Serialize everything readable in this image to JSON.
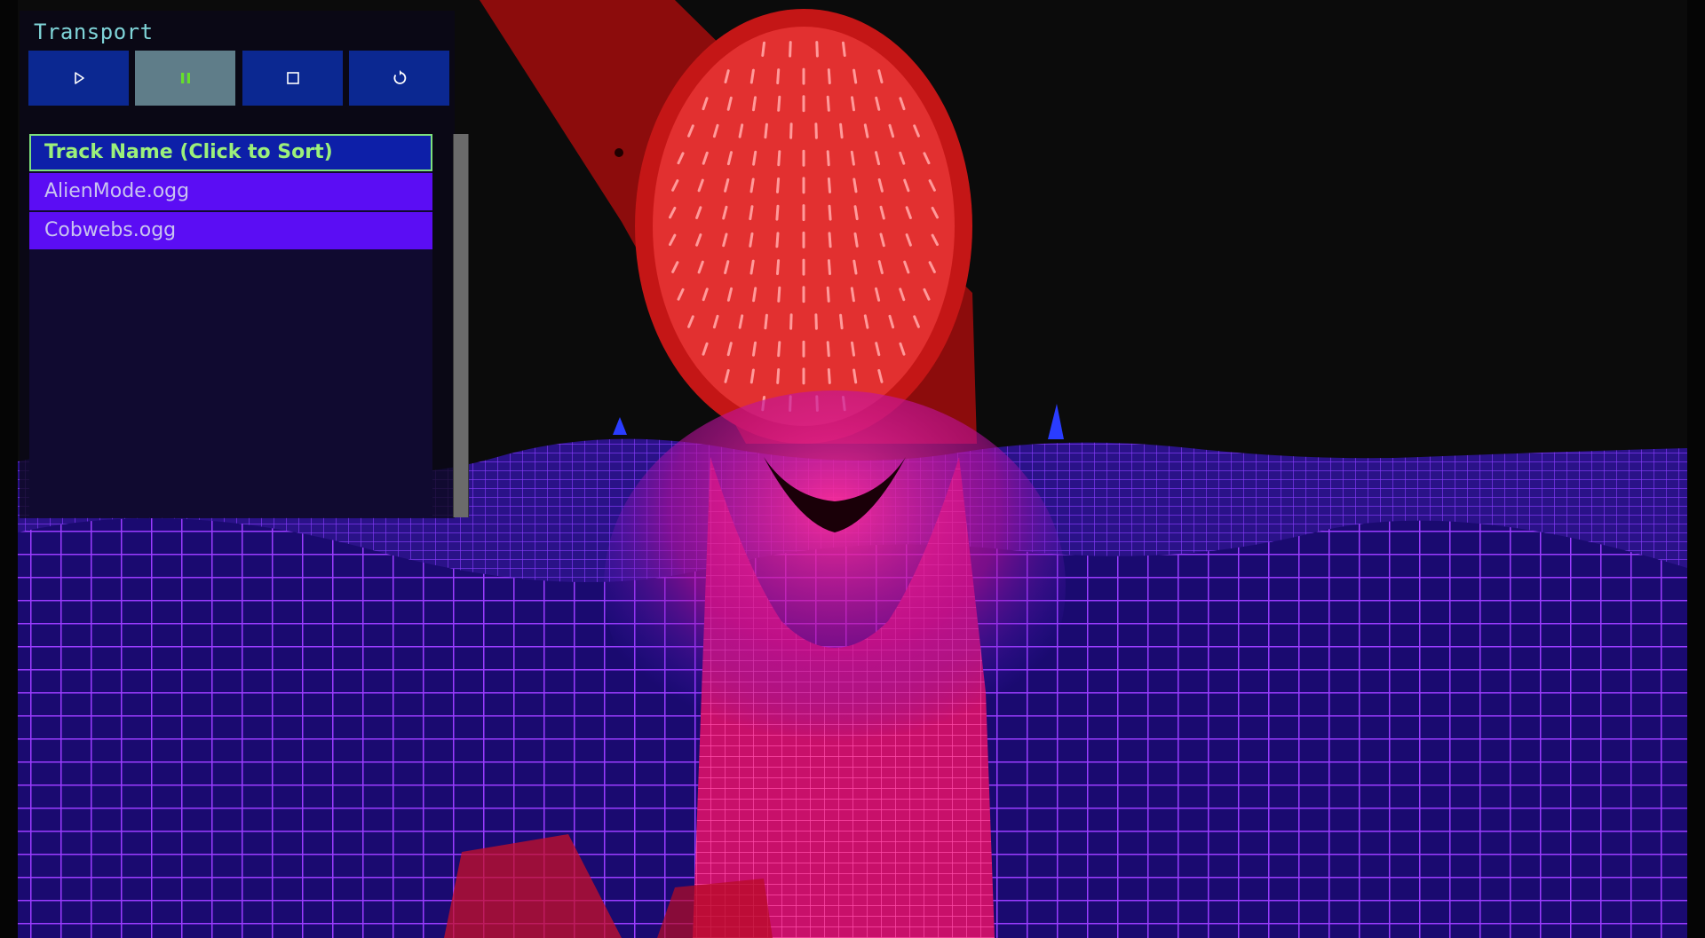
{
  "transport": {
    "title": "Transport",
    "buttons": [
      {
        "id": "play",
        "icon": "play-icon",
        "active": false
      },
      {
        "id": "pause",
        "icon": "pause-icon",
        "active": true
      },
      {
        "id": "stop",
        "icon": "stop-icon",
        "active": false
      },
      {
        "id": "replay",
        "icon": "replay-icon",
        "active": false
      }
    ]
  },
  "tracklist": {
    "header": "Track Name (Click to Sort)",
    "tracks": [
      "AlienMode.ogg",
      "Cobwebs.ogg"
    ]
  },
  "colors": {
    "button_bg": "#0b2891",
    "button_active_bg": "#5f7d89",
    "header_text": "#9cf07a",
    "row_bg": "#5b0df4",
    "row_text": "#c9c4f0",
    "title_text": "#7fd4d8",
    "pause_icon": "#66e02a",
    "mesh_blue": "#4a2cff",
    "mesh_magenta": "#ff1f8a",
    "spike_red": "#d81010"
  }
}
